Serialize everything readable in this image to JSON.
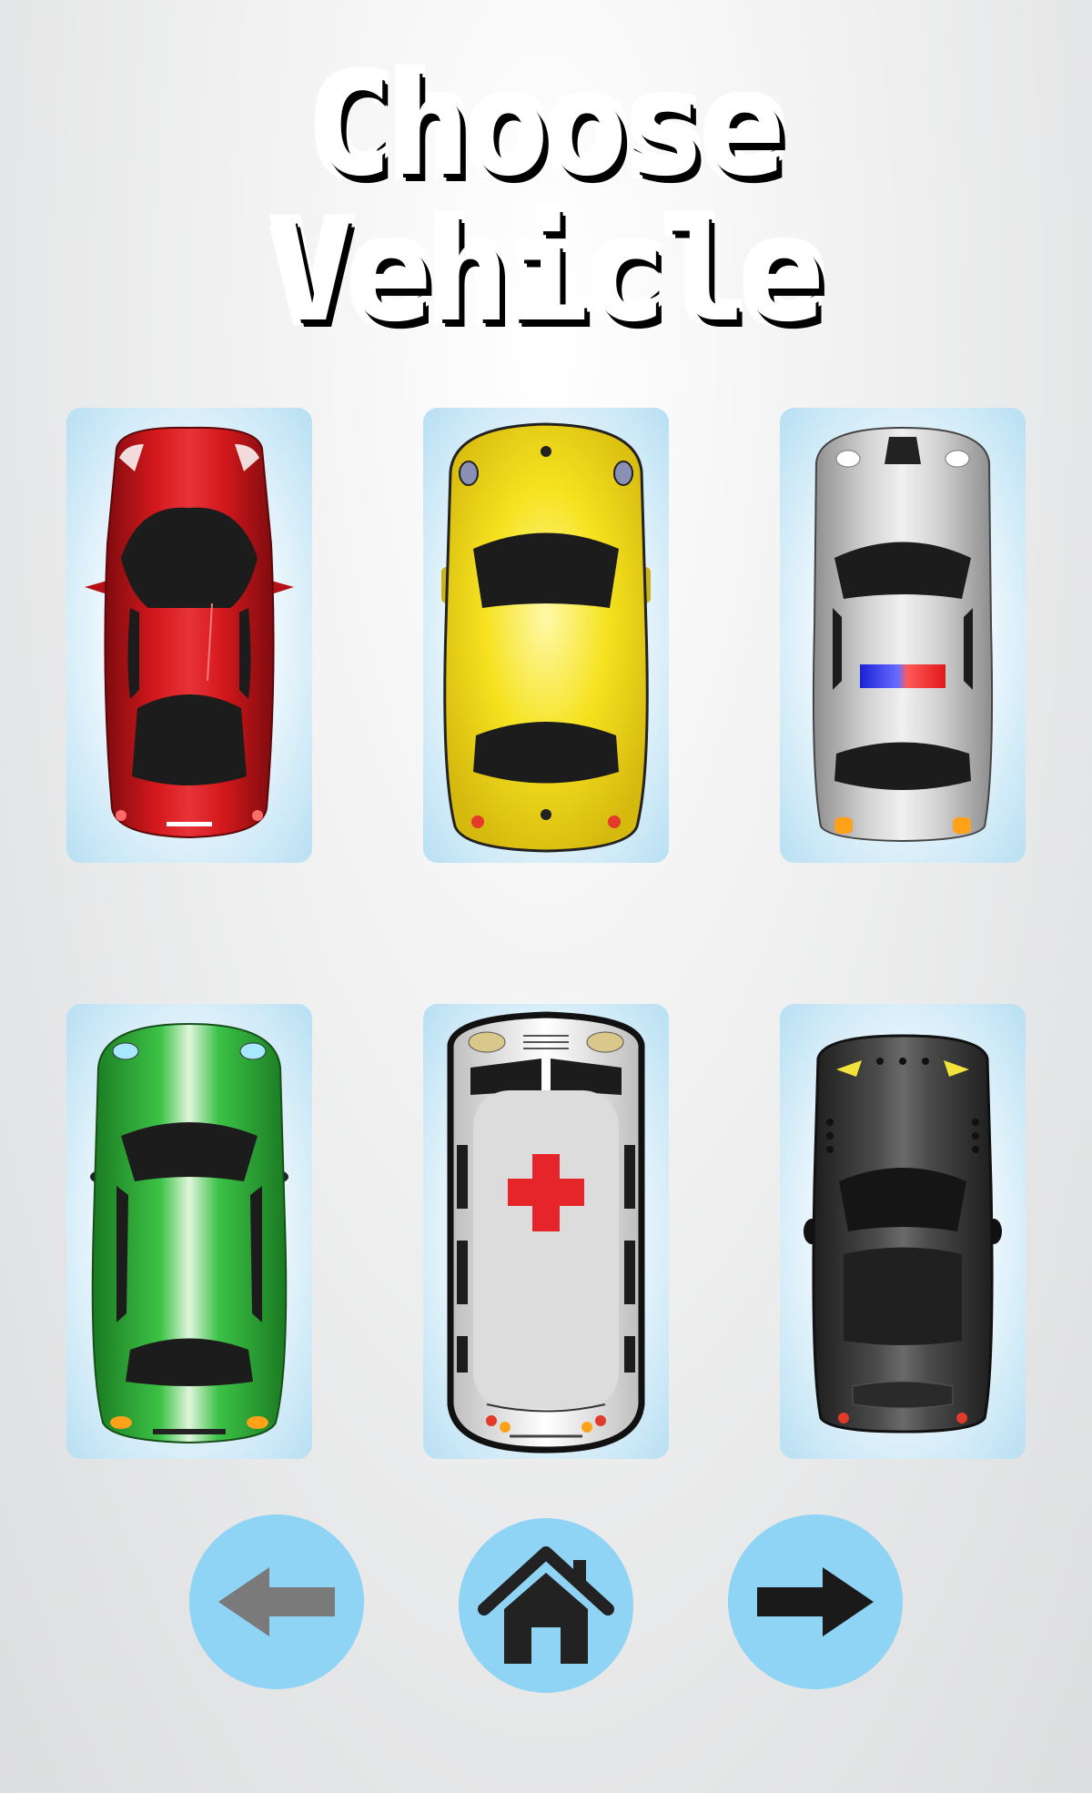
{
  "screen": {
    "title": "Choose Vehicle"
  },
  "vehicles": [
    {
      "id": "red-sports-car",
      "color": "#c8161b"
    },
    {
      "id": "yellow-beetle",
      "color": "#f2dc1e"
    },
    {
      "id": "police-car",
      "color": "#c9c9c9"
    },
    {
      "id": "green-sedan",
      "color": "#2fb23a"
    },
    {
      "id": "ambulance",
      "color": "#e6e6e6"
    },
    {
      "id": "black-sports-car",
      "color": "#3a3a3a"
    }
  ],
  "navigation": {
    "back_icon": "arrow-left-icon",
    "home_icon": "home-icon",
    "next_icon": "arrow-right-icon",
    "button_color": "#8fd3f5",
    "back_arrow_color": "#7a7a7a",
    "home_color": "#222222",
    "next_arrow_color": "#1a1a1a"
  }
}
